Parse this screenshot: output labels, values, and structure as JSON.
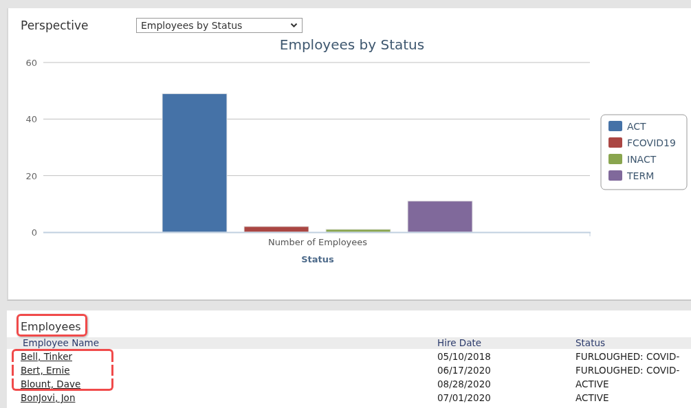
{
  "perspective": {
    "label": "Perspective",
    "value": "Employees by Status"
  },
  "chart": {
    "chart_data": {
      "type": "bar",
      "title": "Employees by Status",
      "xlabel": "Status",
      "categories": [
        "Number of Employees"
      ],
      "series": [
        {
          "name": "ACT",
          "color": "#4572a7",
          "values": [
            49
          ]
        },
        {
          "name": "FCOVID19",
          "color": "#aa4643",
          "values": [
            2
          ]
        },
        {
          "name": "INACT",
          "color": "#89a54e",
          "values": [
            1
          ]
        },
        {
          "name": "TERM",
          "color": "#80699b",
          "values": [
            11
          ]
        }
      ],
      "legend": true,
      "ylim": [
        0,
        60
      ],
      "yticks": [
        0,
        20,
        40,
        60
      ]
    }
  },
  "employees": {
    "title": "Employees",
    "highlighted": true,
    "columns": [
      "Employee Name",
      "Hire Date",
      "Status"
    ],
    "rows": [
      {
        "name": "Bell, Tinker",
        "hire_date": "05/10/2018",
        "status": "FURLOUGHED: COVID-",
        "highlighted": true
      },
      {
        "name": "Bert, Ernie",
        "hire_date": "06/17/2020",
        "status": "FURLOUGHED: COVID-",
        "highlighted": true
      },
      {
        "name": "Blount, Dave",
        "hire_date": "08/28/2020",
        "status": "ACTIVE",
        "highlighted": true
      },
      {
        "name": "BonJovi, Jon",
        "hire_date": "07/01/2020",
        "status": "ACTIVE",
        "highlighted": false
      }
    ]
  }
}
